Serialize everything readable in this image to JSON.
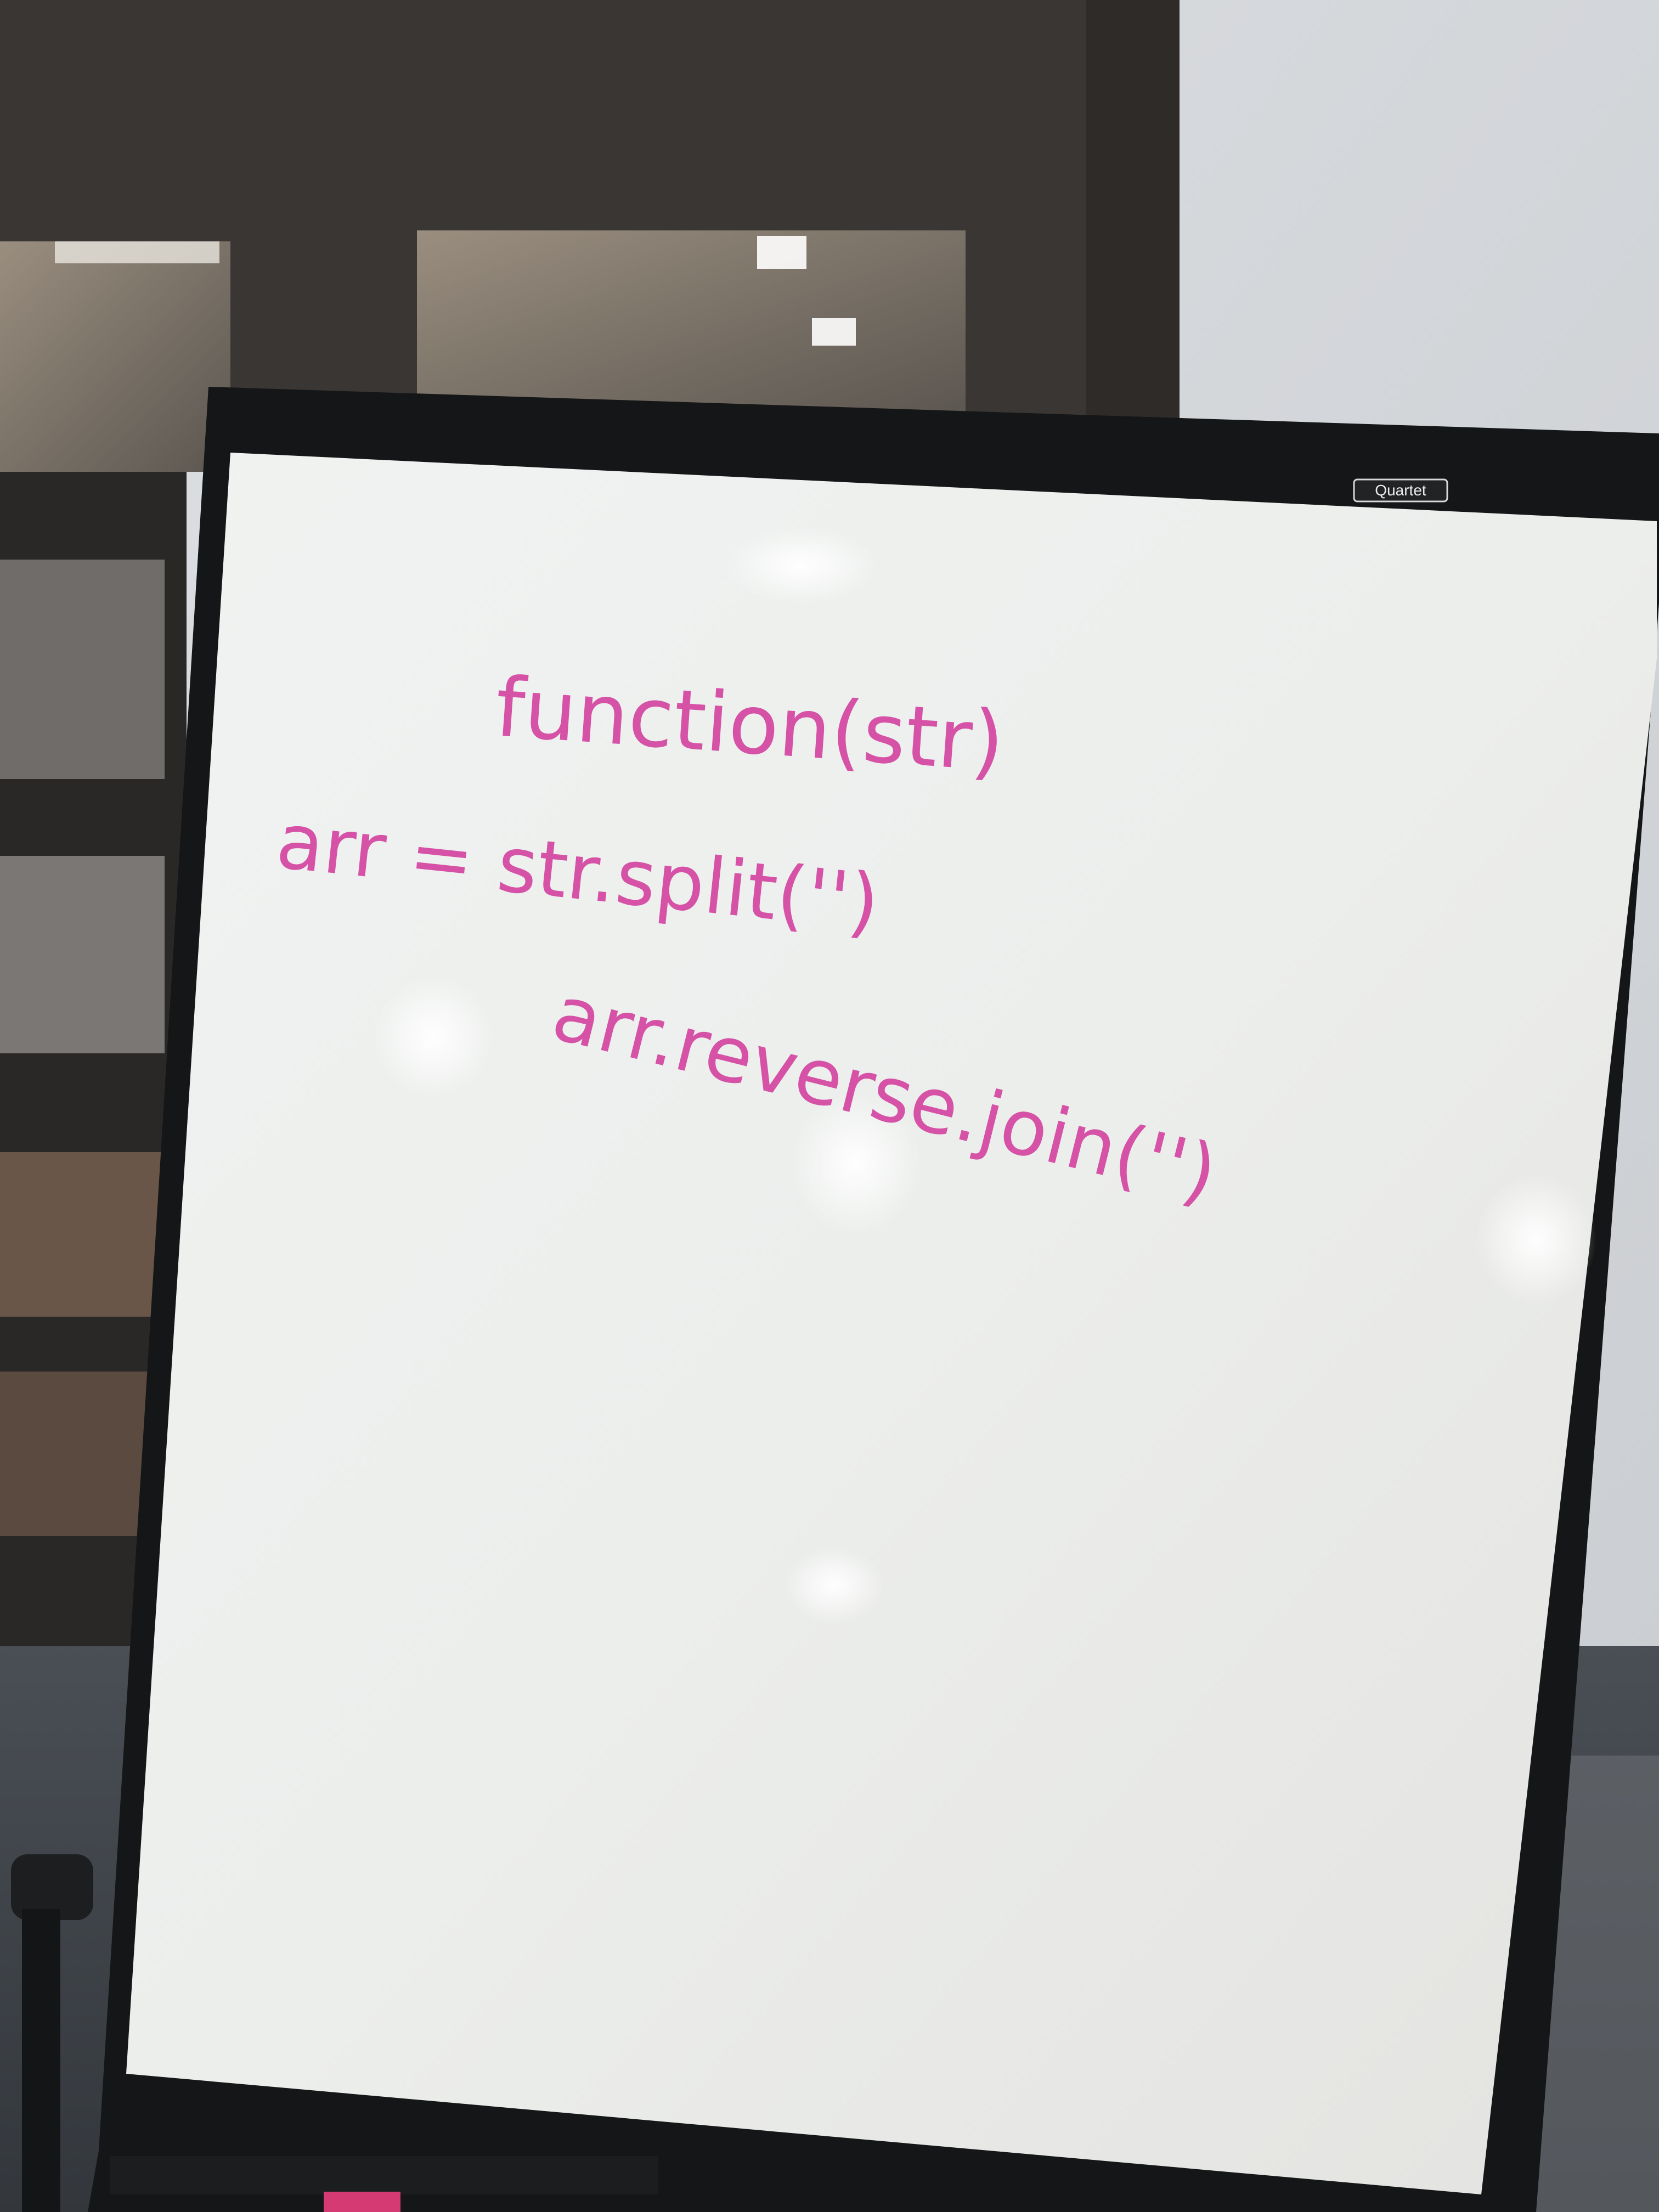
{
  "board": {
    "brand": "Quartet",
    "lines": [
      "function(str)",
      "arr = str.split('')",
      "arr.reverse.join('')"
    ]
  },
  "colors": {
    "marker": "#d23d9e",
    "board_surface": "#eef0ee",
    "frame": "#151617",
    "wall": "#e4e6e8",
    "door_frame": "#3a3634",
    "carpet": "#3e4348"
  }
}
